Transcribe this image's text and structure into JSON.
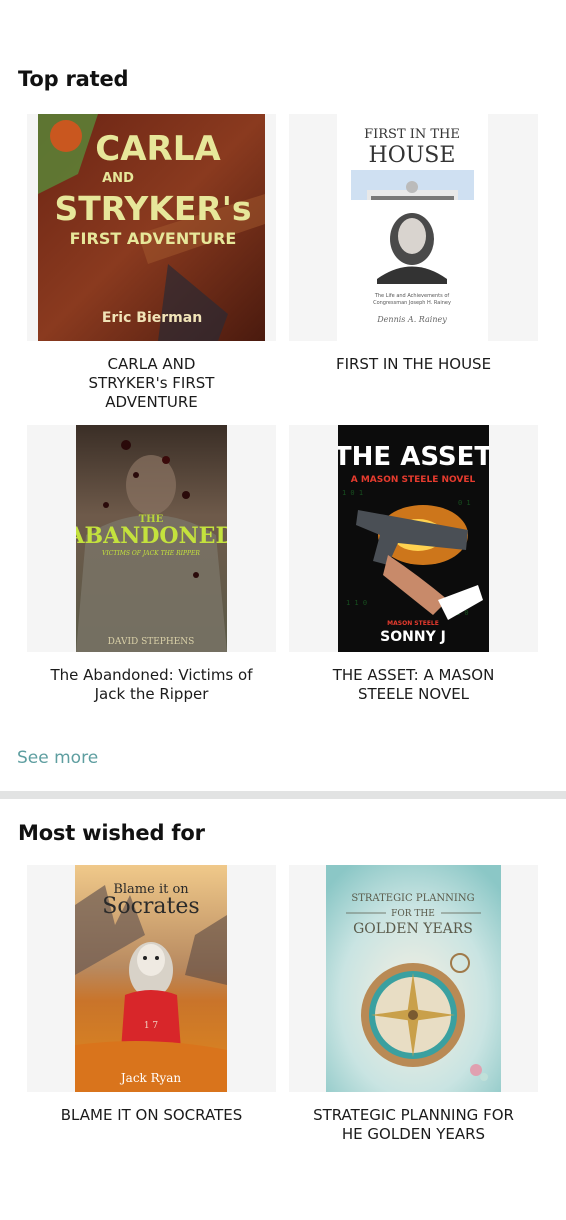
{
  "top_rated": {
    "title": "Top rated",
    "books": [
      {
        "title": "CARLA AND STRYKER's FIRST ADVENTURE",
        "cover_text": {
          "line1": "CARLA",
          "line2": "AND",
          "line3": "STRYKER's",
          "line4": "FIRST ADVENTURE",
          "author": "Eric Bierman"
        }
      },
      {
        "title": "FIRST IN THE HOUSE",
        "cover_text": {
          "line1": "FIRST IN THE",
          "line2": "HOUSE",
          "subtitle": "The Life and Achievements of Congressman Joseph H. Rainey",
          "author": "Dennis A. Rainey"
        }
      },
      {
        "title": "The Abandoned: Victims of Jack the Ripper",
        "cover_text": {
          "line1": "THE",
          "line2": "ABANDONED",
          "subtitle": "VICTIMS OF JACK THE RIPPER",
          "author": "DAVID STEPHENS"
        }
      },
      {
        "title": "THE ASSET: A MASON STEELE NOVEL",
        "cover_text": {
          "line1": "THE ASSET",
          "line2": "A MASON STEELE NOVEL",
          "badge": "MASON STEELE",
          "author": "SONNY J"
        }
      }
    ]
  },
  "see_more": "See more",
  "most_wished": {
    "title": "Most wished for",
    "books": [
      {
        "title": "BLAME IT ON SOCRATES",
        "cover_text": {
          "line1": "Blame it on",
          "line2": "Socrates",
          "author": "Jack Ryan"
        }
      },
      {
        "title": "STRATEGIC PLANNING FOR HE GOLDEN YEARS",
        "cover_text": {
          "line1": "STRATEGIC PLANNING",
          "line2": "FOR THE",
          "line3": "GOLDEN YEARS"
        }
      }
    ]
  },
  "colors": {
    "see_more": "#5e9ea0",
    "divider": "#e2e3e3",
    "card_bg": "#f5f5f5"
  }
}
